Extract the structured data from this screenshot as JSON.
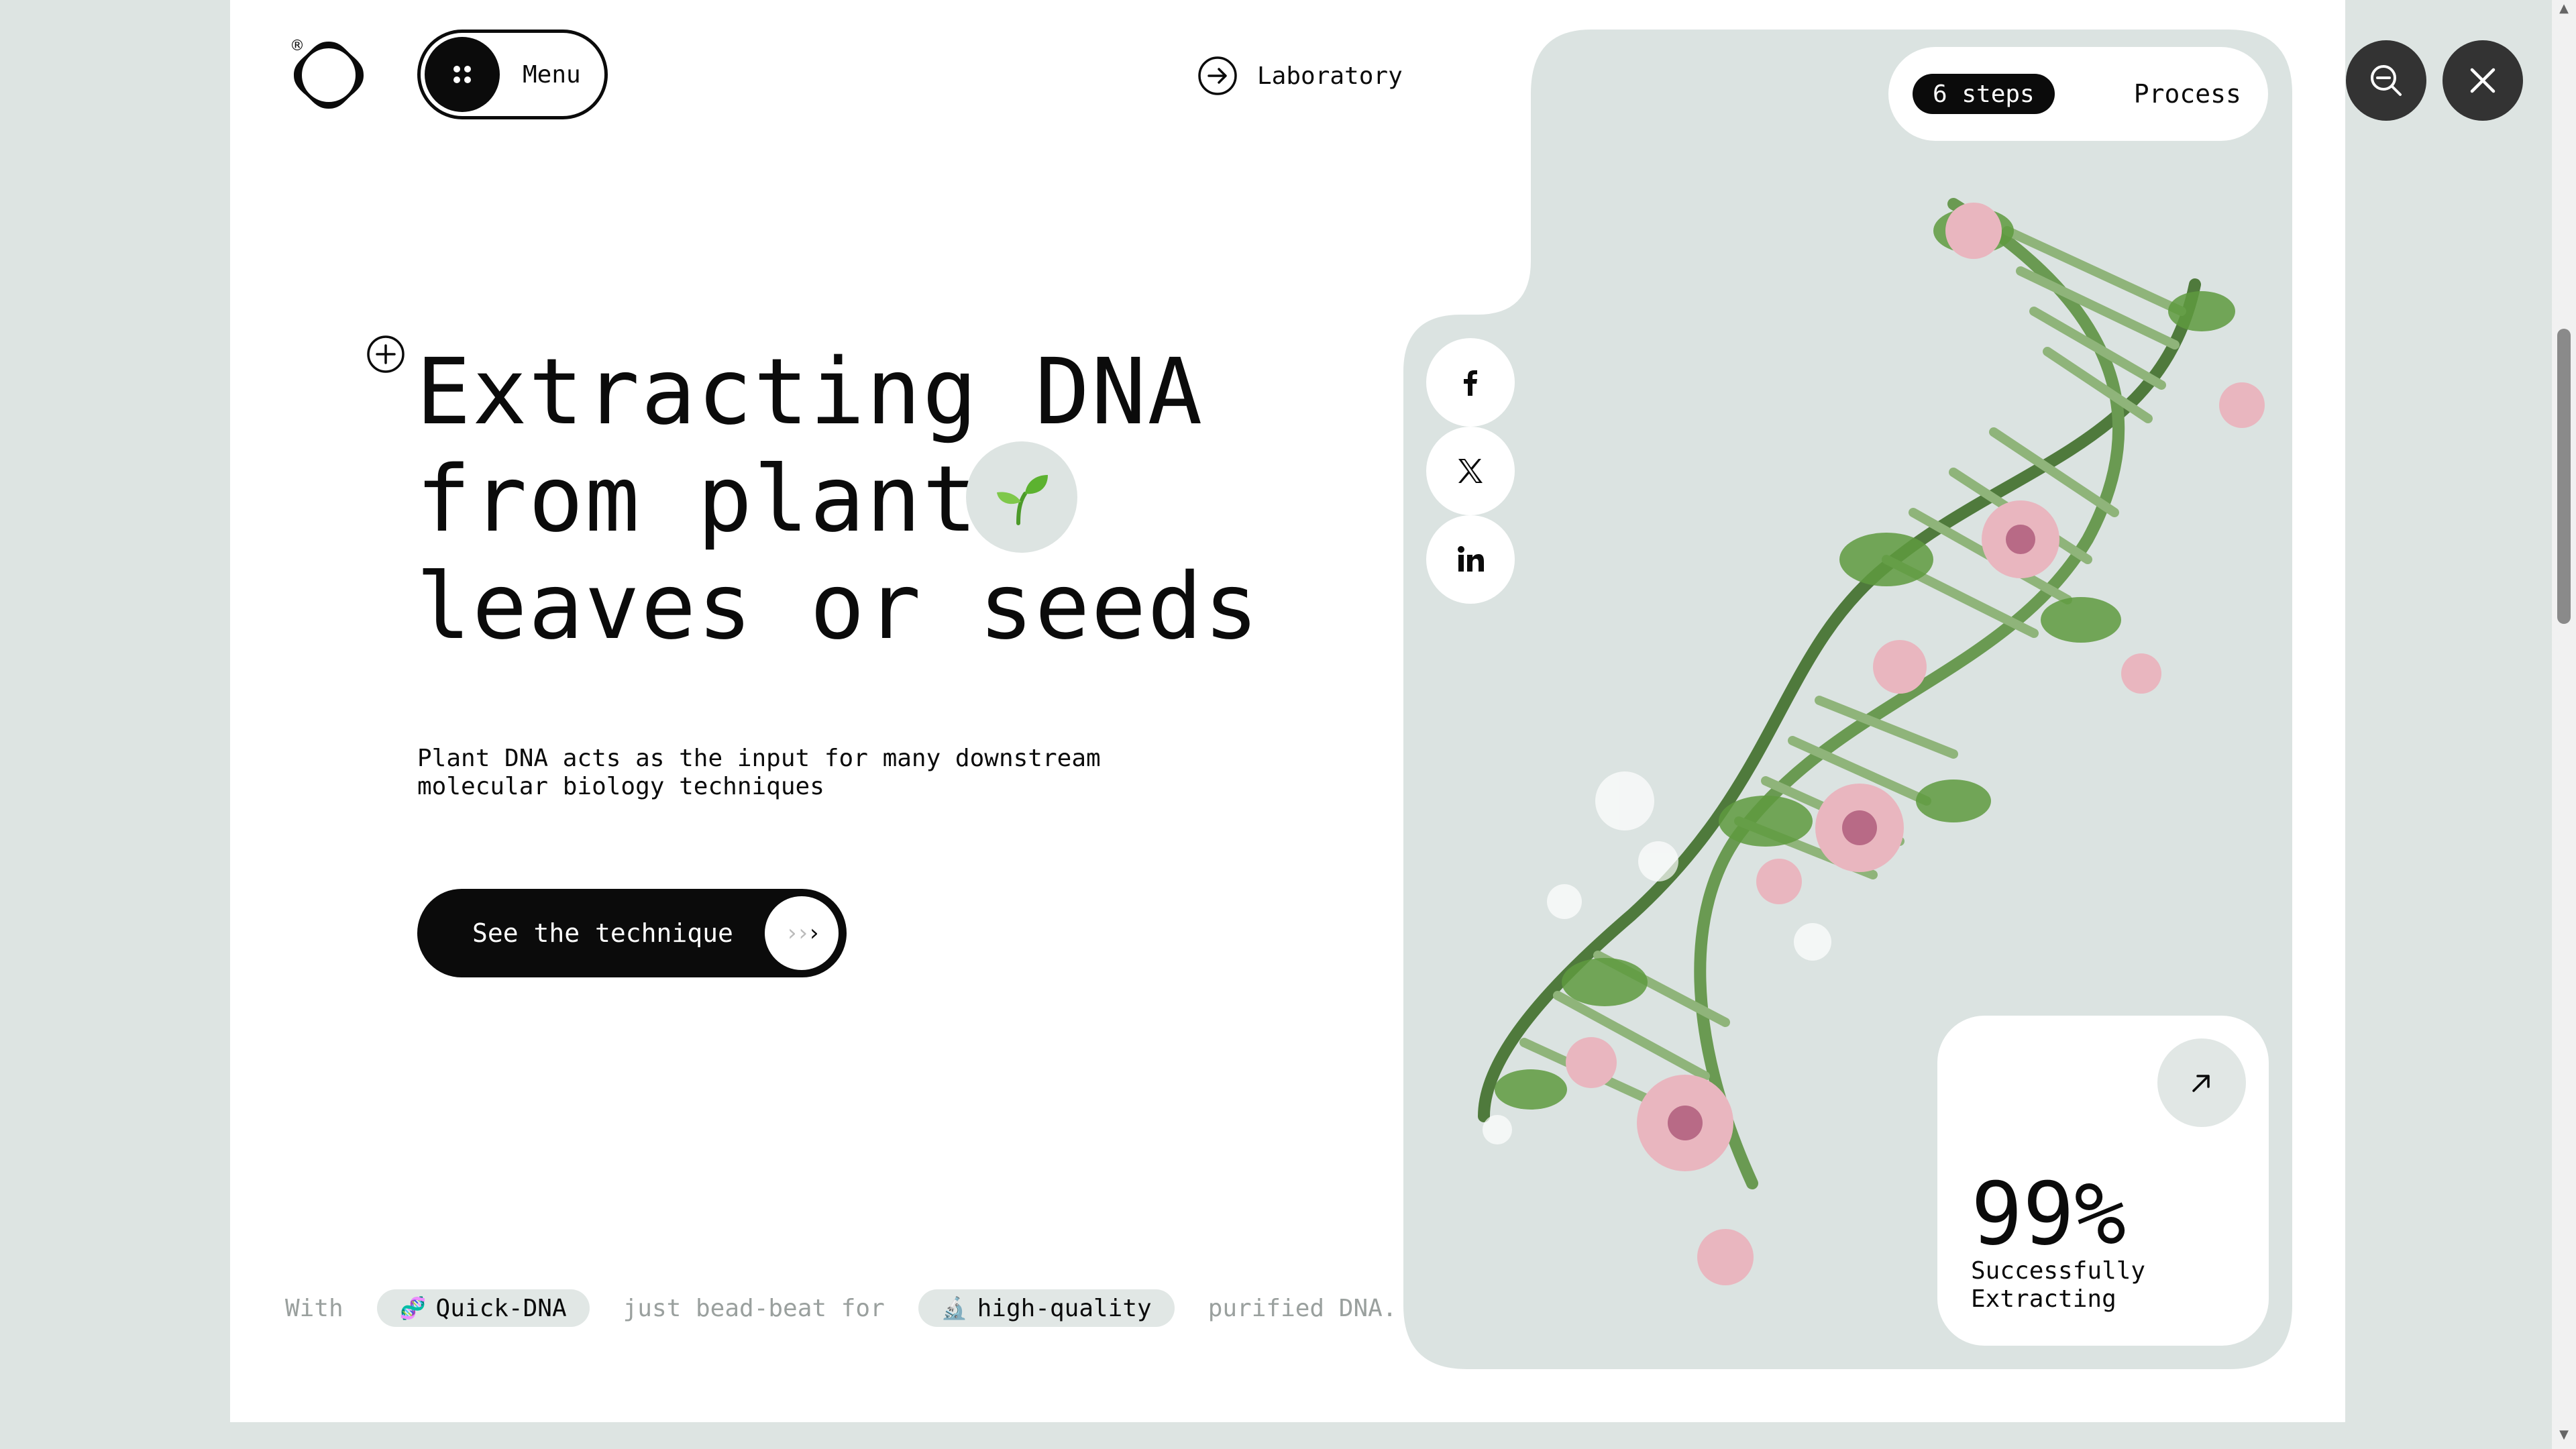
{
  "header": {
    "logo_mark": "®",
    "menu_label": "Menu",
    "lab_link_label": "Laboratory"
  },
  "hero": {
    "title_lines": [
      "Extracting DNA",
      "from plant",
      "leaves or seeds"
    ],
    "subtitle": "Plant DNA acts as the input for many downstream molecular biology techniques",
    "cta_label": "See the technique",
    "sprout_icon": "seedling-icon"
  },
  "strip": {
    "w1": "With",
    "chip1_icon": "🧬",
    "chip1": "Quick-DNA",
    "w2": "just bead-beat for",
    "chip2_icon": "🔬",
    "chip2": "high-quality",
    "w3": "purified DNA."
  },
  "panel": {
    "steps_badge": "6 steps",
    "process_label": "Process",
    "social": [
      "facebook-icon",
      "x-icon",
      "linkedin-icon"
    ],
    "stat_value": "99%",
    "stat_caption": "Successfully Extracting"
  },
  "colors": {
    "background": "#dde4e2",
    "ink": "#0b0b0b",
    "panel": "#dbe3e1"
  }
}
